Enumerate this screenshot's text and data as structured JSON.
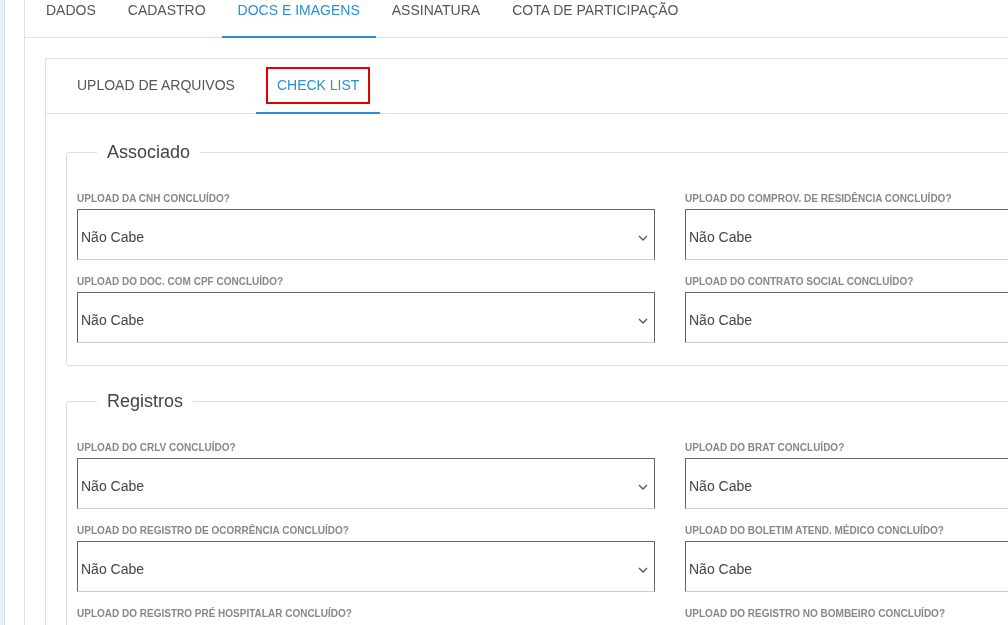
{
  "main_tabs": [
    {
      "label": "DADOS",
      "selected": false
    },
    {
      "label": "CADASTRO",
      "selected": false
    },
    {
      "label": "DOCS E IMAGENS",
      "selected": true
    },
    {
      "label": "ASSINATURA",
      "selected": false
    },
    {
      "label": "COTA DE PARTICIPAÇÃO",
      "selected": false
    }
  ],
  "sub_tabs": [
    {
      "label": "UPLOAD DE ARQUIVOS",
      "selected": false,
      "highlighted": false
    },
    {
      "label": "CHECK LIST",
      "selected": true,
      "highlighted": true
    }
  ],
  "sections": [
    {
      "title": "Associado",
      "fields": [
        {
          "label": "UPLOAD DA CNH CONCLUÍDO?",
          "value": "Não Cabe"
        },
        {
          "label": "UPLOAD DO COMPROV. DE RESIDÊNCIA CONCLUÍDO?",
          "value": "Não Cabe"
        },
        {
          "label": "UPLOAD DO DOC. COM CPF CONCLUÍDO?",
          "value": "Não Cabe"
        },
        {
          "label": "UPLOAD DO CONTRATO SOCIAL CONCLUÍDO?",
          "value": "Não Cabe"
        }
      ]
    },
    {
      "title": "Registros",
      "fields": [
        {
          "label": "UPLOAD DO CRLV CONCLUÍDO?",
          "value": "Não Cabe"
        },
        {
          "label": "UPLOAD DO BRAT CONCLUÍDO?",
          "value": "Não Cabe"
        },
        {
          "label": "UPLOAD DO REGISTRO DE OCORRÊNCIA CONCLUÍDO?",
          "value": "Não Cabe"
        },
        {
          "label": "UPLOAD DO BOLETIM ATEND. MÉDICO CONCLUÍDO?",
          "value": "Não Cabe"
        },
        {
          "label": "UPLOAD DO REGISTRO PRÉ HOSPITALAR CONCLUÍDO?"
        },
        {
          "label": "UPLOAD DO REGISTRO NO BOMBEIRO CONCLUÍDO?"
        }
      ]
    }
  ]
}
